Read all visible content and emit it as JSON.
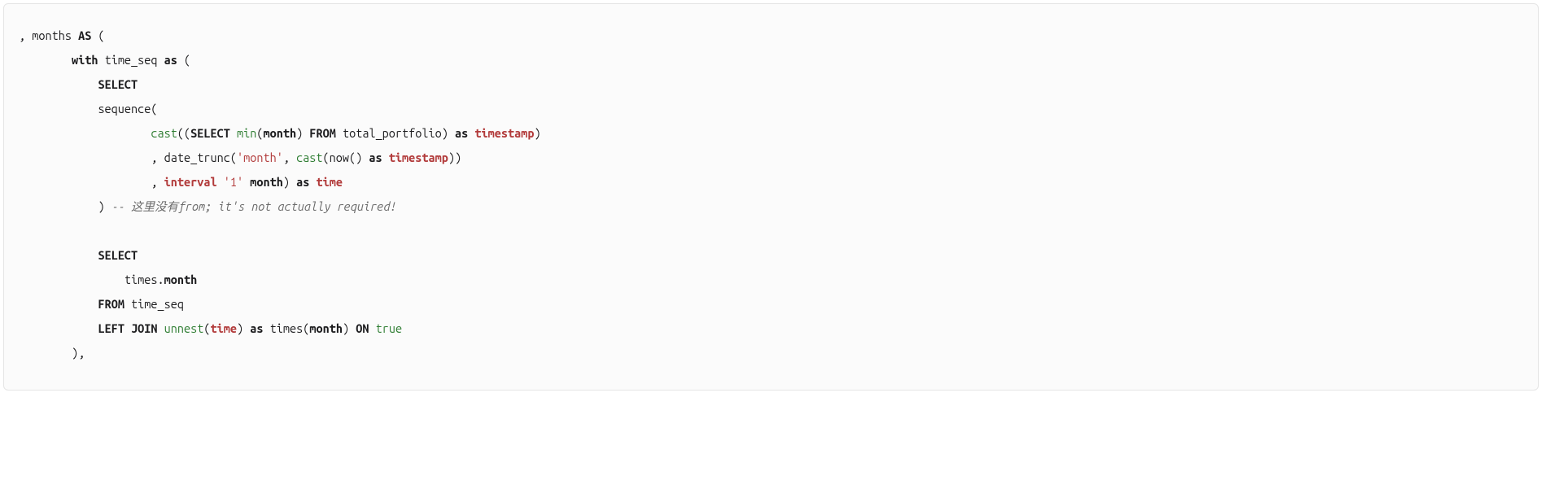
{
  "code": {
    "l1": {
      "a": ", months ",
      "b": "AS",
      "c": " ("
    },
    "l2": {
      "a": "        ",
      "b": "with",
      "c": " time_seq ",
      "d": "as",
      "e": " ("
    },
    "l3": {
      "a": "            ",
      "b": "SELECT"
    },
    "l4": {
      "a": "            sequence("
    },
    "l5": {
      "a": "                    ",
      "b": "cast",
      "c": "((",
      "d": "SELECT",
      "e": " ",
      "f": "min",
      "g": "(",
      "h": "month",
      "i": ") ",
      "j": "FROM",
      "k": " total_portfolio) ",
      "l": "as",
      "m": " ",
      "n": "timestamp",
      "o": ")"
    },
    "l6": {
      "a": "                    , date_trunc(",
      "b": "'month'",
      "c": ", ",
      "d": "cast",
      "e": "(now() ",
      "f": "as",
      "g": " ",
      "h": "timestamp",
      "i": "))"
    },
    "l7": {
      "a": "                    , ",
      "b": "interval",
      "c": " ",
      "d": "'1'",
      "e": " ",
      "f": "month",
      "g": ") ",
      "h": "as",
      "i": " ",
      "j": "time"
    },
    "l8": {
      "a": "            ) ",
      "b": "-- 这里没有from; it's not actually required!"
    },
    "l9": {
      "a": ""
    },
    "l10": {
      "a": "            ",
      "b": "SELECT"
    },
    "l11": {
      "a": "                times.",
      "b": "month"
    },
    "l12": {
      "a": "            ",
      "b": "FROM",
      "c": " time_seq"
    },
    "l13": {
      "a": "            ",
      "b": "LEFT",
      "c": " ",
      "d": "JOIN",
      "e": " ",
      "f": "unnest",
      "g": "(",
      "h": "time",
      "i": ") ",
      "j": "as",
      "k": " times(",
      "l": "month",
      "m": ") ",
      "n": "ON",
      "o": " ",
      "p": "true"
    },
    "l14": {
      "a": "        ),"
    }
  }
}
